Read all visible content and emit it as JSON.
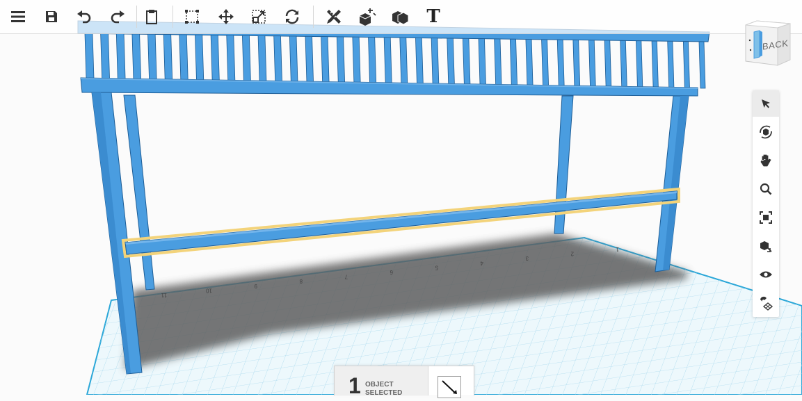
{
  "colors": {
    "part_fill": "#4a9de0",
    "part_edge": "#1d5d96",
    "selection": "#f3d37a",
    "grid_line": "#9fd3eb",
    "grid_major": "#2ba7d8",
    "grid_fill": "#e9f6fb",
    "shadow": "#5a5a5a"
  },
  "toolbar": {
    "items": [
      {
        "name": "menu-button",
        "icon": "hamburger-icon"
      },
      {
        "name": "save-button",
        "icon": "floppy-disk-icon"
      },
      {
        "name": "undo-button",
        "icon": "undo-icon"
      },
      {
        "name": "redo-button",
        "icon": "redo-icon"
      },
      {
        "name": "paste-button",
        "icon": "clipboard-icon"
      },
      {
        "name": "select-bounding-button",
        "icon": "bounding-box-icon"
      },
      {
        "name": "move-button",
        "icon": "move-arrows-icon"
      },
      {
        "name": "scale-button",
        "icon": "scale-icon"
      },
      {
        "name": "rotate-button",
        "icon": "rotate-icon"
      },
      {
        "name": "measure-button",
        "icon": "ruler-pencil-icon"
      },
      {
        "name": "cube-button",
        "icon": "cube-arrows-icon"
      },
      {
        "name": "group-button",
        "icon": "group-blocks-icon"
      },
      {
        "name": "text-button",
        "icon": "text-t-icon"
      }
    ],
    "text_glyph": "T"
  },
  "view_cube": {
    "label": "BACK"
  },
  "sidebar": {
    "tools": [
      {
        "name": "select-tool",
        "icon": "pointer-arrow-icon",
        "active": true
      },
      {
        "name": "orbit-tool",
        "icon": "orbit-icon",
        "active": false
      },
      {
        "name": "pan-tool",
        "icon": "hand-icon",
        "active": false
      },
      {
        "name": "zoom-tool",
        "icon": "magnifier-icon",
        "active": false
      },
      {
        "name": "fit-view-tool",
        "icon": "fit-frame-icon",
        "active": false
      },
      {
        "name": "perspective-tool",
        "icon": "cube-view-icon",
        "active": false
      },
      {
        "name": "visibility-tool",
        "icon": "eye-icon",
        "active": false
      },
      {
        "name": "snap-tool",
        "icon": "magnet-grid-icon",
        "active": false
      }
    ]
  },
  "selection": {
    "count": "1",
    "label_line1": "OBJECT",
    "label_line2": "SELECTED",
    "tool_icon": "pencil-line-icon"
  },
  "grid": {
    "tick_labels": [
      "11",
      "10",
      "9",
      "8",
      "7",
      "6",
      "5",
      "4",
      "3",
      "2",
      "1"
    ]
  }
}
